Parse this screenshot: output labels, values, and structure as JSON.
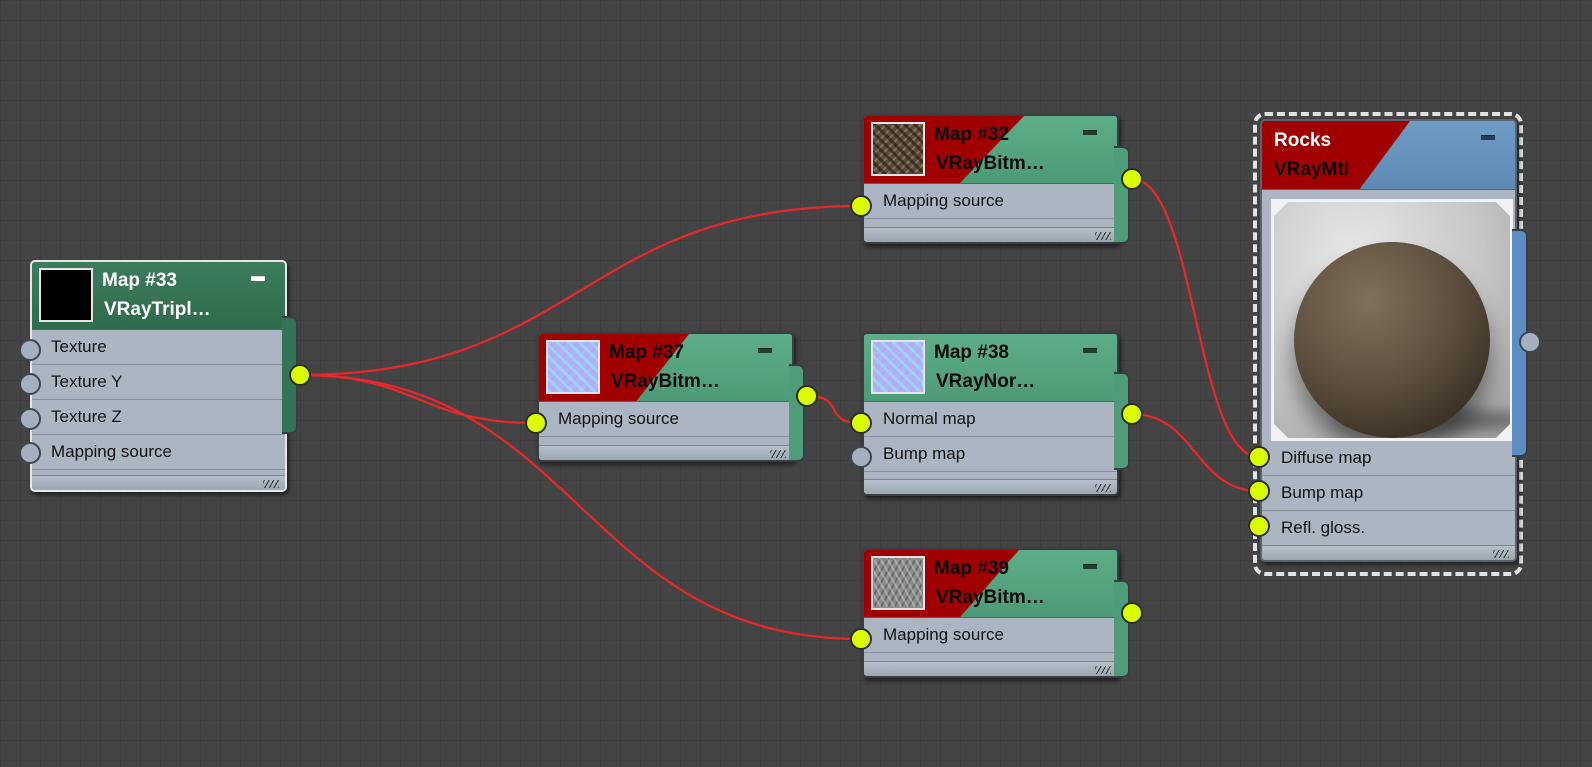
{
  "nodes": {
    "map33": {
      "title": "Map #33",
      "type": "VRayTripl…",
      "slots": [
        "Texture",
        "Texture Y",
        "Texture Z",
        "Mapping source"
      ]
    },
    "map32": {
      "title": "Map #32",
      "type": "VRayBitm…",
      "slots": [
        "Mapping source"
      ]
    },
    "map37": {
      "title": "Map #37",
      "type": "VRayBitm…",
      "slots": [
        "Mapping source"
      ]
    },
    "map38": {
      "title": "Map #38",
      "type": "VRayNor…",
      "slots": [
        "Normal map",
        "Bump map"
      ]
    },
    "map39": {
      "title": "Map #39",
      "type": "VRayBitm…",
      "slots": [
        "Mapping source"
      ]
    },
    "rocks": {
      "title": "Rocks",
      "type": "VRayMtl",
      "slots": [
        "Diffuse map",
        "Bump map",
        "Refl. gloss."
      ]
    }
  },
  "colors": {
    "background": "#444444",
    "wire": "#e8282a",
    "port_connected": "#d9ff00",
    "port_empty": "#a4b0c0",
    "header_map": "#5cae88",
    "header_triplanar": "#3c7c5c",
    "header_material": "#6f9cc4",
    "red_wedge": "#a10000"
  },
  "connections": [
    {
      "from": "map33.out",
      "to": "map32.Mapping source"
    },
    {
      "from": "map33.out",
      "to": "map37.Mapping source"
    },
    {
      "from": "map33.out",
      "to": "map39.Mapping source"
    },
    {
      "from": "map37.out",
      "to": "map38.Normal map"
    },
    {
      "from": "map32.out",
      "to": "rocks.Diffuse map"
    },
    {
      "from": "map38.out",
      "to": "rocks.Bump map"
    },
    {
      "from": "map39.out",
      "to": "rocks.Refl. gloss."
    }
  ]
}
